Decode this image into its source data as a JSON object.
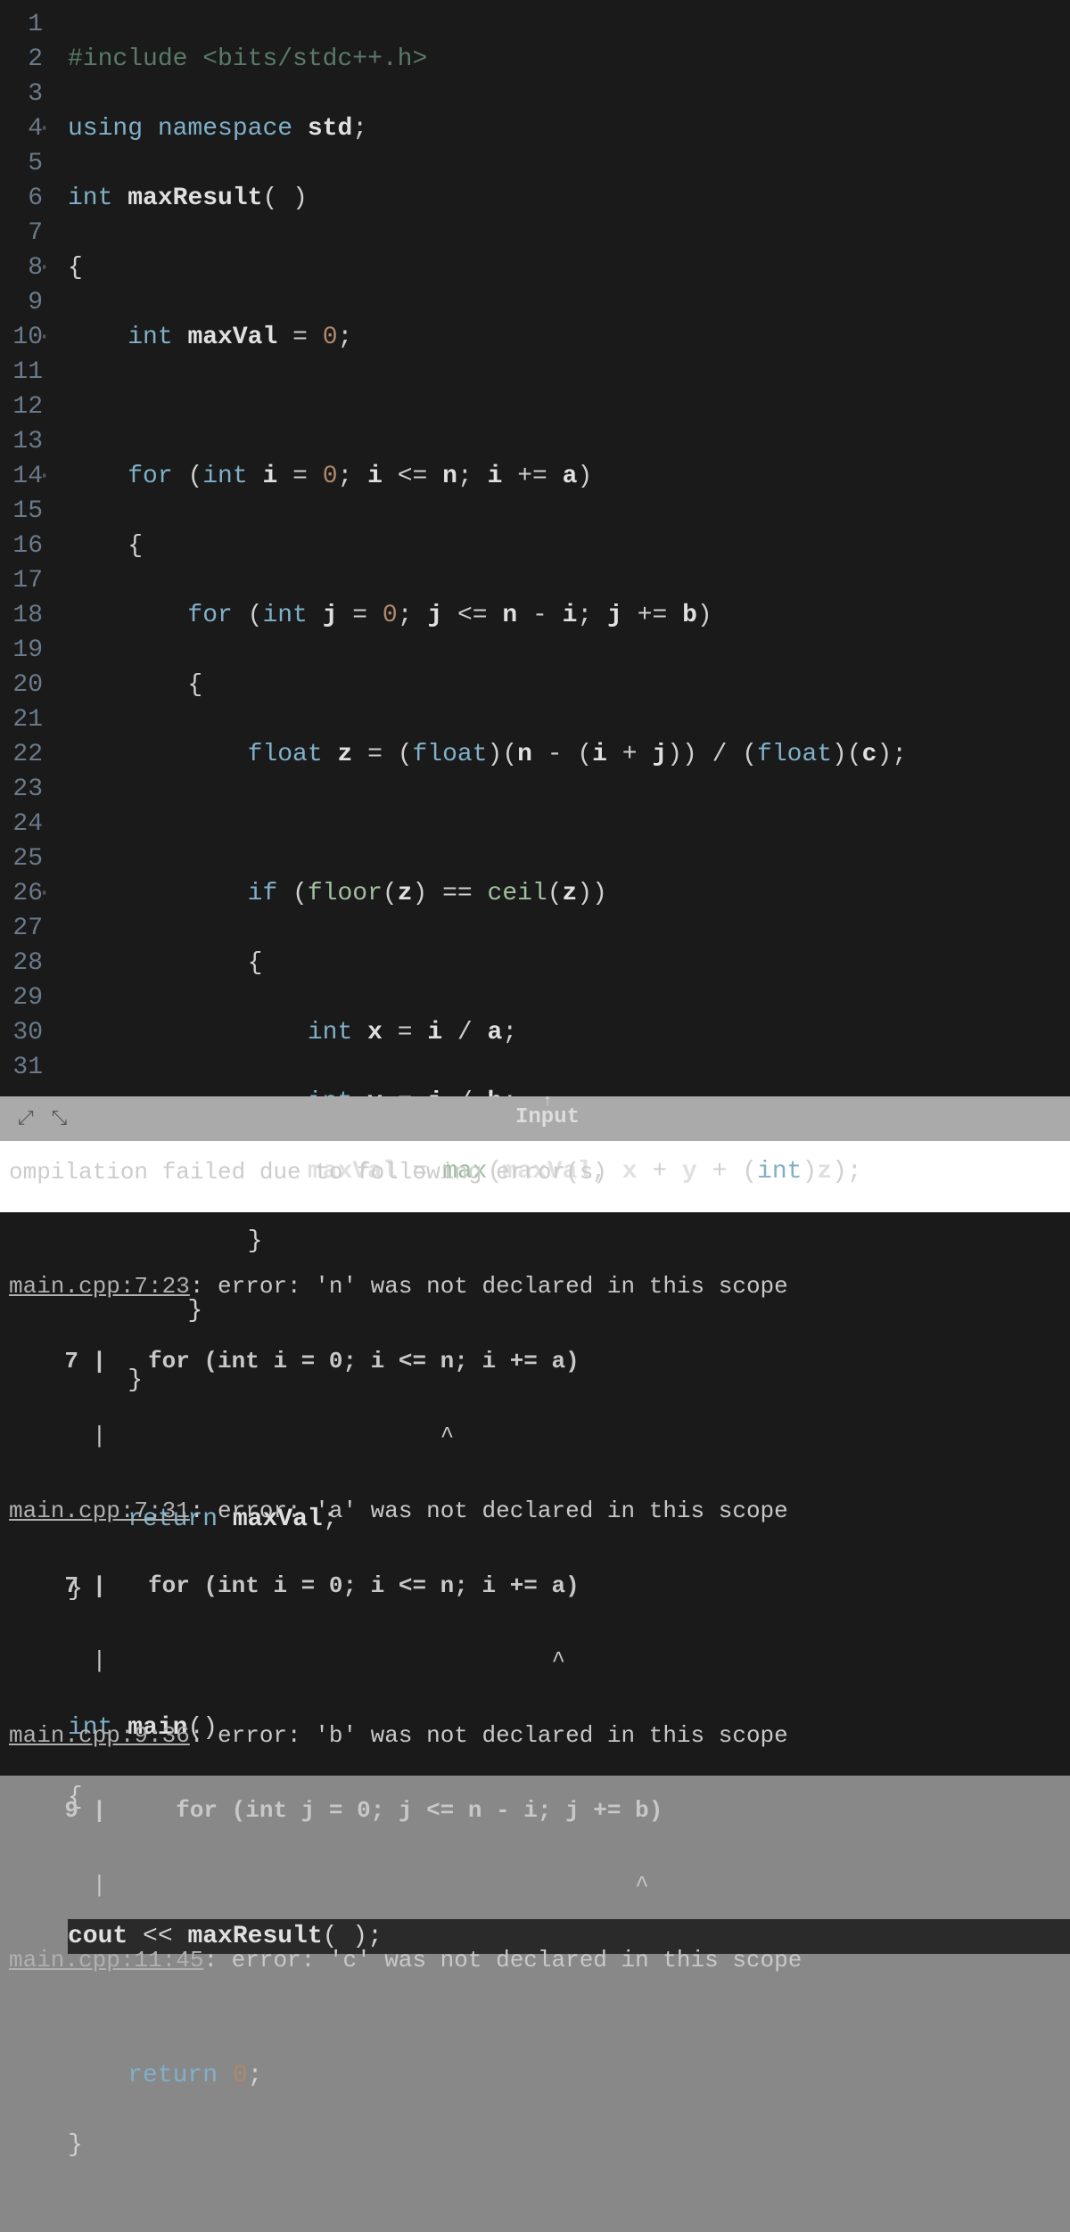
{
  "editor": {
    "line_count": 31,
    "current_line": 28,
    "fold_lines": [
      4,
      8,
      10,
      14,
      26
    ],
    "code": {
      "l1_pp": "#include",
      "l1_inc": "<bits/stdc++.h>",
      "l2_using": "using",
      "l2_ns": "namespace",
      "l2_std": "std",
      "l3_int": "int",
      "l3_fn": "maxResult",
      "l4": "{",
      "l5_int": "int",
      "l5_var": "maxVal",
      "l5_eq": "=",
      "l5_zero": "0",
      "l7_for": "for",
      "l7_int": "int",
      "l7_i": "i",
      "l7_z": "0",
      "l7_n": "n",
      "l7_a": "a",
      "l8": "{",
      "l9_for": "for",
      "l9_int": "int",
      "l9_j": "j",
      "l9_z": "0",
      "l9_n": "n",
      "l9_i": "i",
      "l9_b": "b",
      "l10": "{",
      "l11_float": "float",
      "l11_z": "z",
      "l11_cast": "float",
      "l11_n": "n",
      "l11_i": "i",
      "l11_j": "j",
      "l11_c": "c",
      "l13_if": "if",
      "l13_floor": "floor",
      "l13_z1": "z",
      "l13_ceil": "ceil",
      "l13_z2": "z",
      "l14": "{",
      "l15_int": "int",
      "l15_x": "x",
      "l15_i": "i",
      "l15_a": "a",
      "l16_int": "int",
      "l16_y": "y",
      "l16_j": "j",
      "l16_b": "b",
      "l17_mv": "maxVal",
      "l17_max": "max",
      "l17_mv2": "maxVal",
      "l17_x": "x",
      "l17_y": "y",
      "l17_int": "int",
      "l17_z": "z",
      "l18": "}",
      "l19": "}",
      "l20": "}",
      "l22_ret": "return",
      "l22_mv": "maxVal",
      "l23": "}",
      "l25_int": "int",
      "l25_main": "main",
      "l26": "{",
      "l28_cout": "cout",
      "l28_fn": "maxResult",
      "l30_ret": "return",
      "l30_z": "0",
      "l31": "}"
    }
  },
  "divider": {
    "input_label": "Input"
  },
  "compile_header": "ompilation failed due to following error(s)",
  "errors": [
    {
      "loc": "main.cpp:7:23",
      "msg": ": error: 'n' was not declared in this scope",
      "src_ln": "    7 |   for (int i = 0; i <= n; i += a)",
      "caret": "      |                        ^"
    },
    {
      "loc": "main.cpp:7:31",
      "msg": ": error: 'a' was not declared in this scope",
      "src_ln": "    7 |   for (int i = 0; i <= n; i += a)",
      "caret": "      |                                ^"
    },
    {
      "loc": "main.cpp:9:36",
      "msg": ": error: 'b' was not declared in this scope",
      "src_ln": "    9 |     for (int j = 0; j <= n - i; j += b)",
      "caret": "      |                                      ^"
    },
    {
      "loc": "main.cpp:11:45",
      "msg": ": error: 'c' was not declared in this scope",
      "src_ln": "",
      "caret": ""
    }
  ]
}
